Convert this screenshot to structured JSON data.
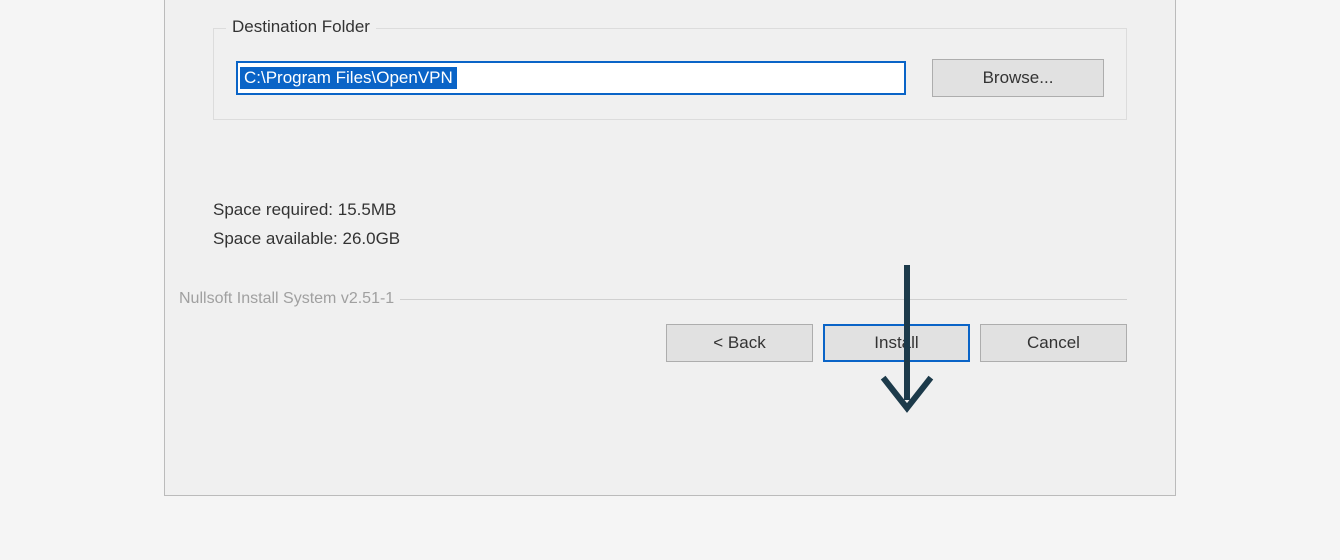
{
  "fieldset": {
    "legend": "Destination Folder",
    "path_value": "C:\\Program Files\\OpenVPN",
    "browse_label": "Browse..."
  },
  "space": {
    "required_label": "Space required: ",
    "required_value": "15.5MB",
    "available_label": "Space available: ",
    "available_value": "26.0GB"
  },
  "system_label": "Nullsoft Install System v2.51-1",
  "buttons": {
    "back": "< Back",
    "install": "Install",
    "cancel": "Cancel"
  },
  "colors": {
    "accent": "#0a64c7",
    "arrow": "#1c3a4a"
  }
}
